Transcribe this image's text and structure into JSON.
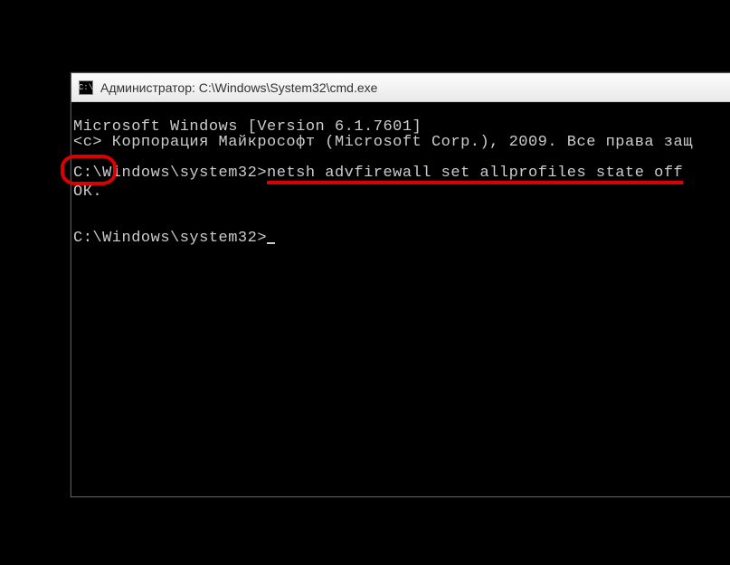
{
  "window": {
    "title": "Администратор: C:\\Windows\\System32\\cmd.exe",
    "icon_label": "C:\\"
  },
  "console": {
    "banner_line1": "Microsoft Windows [Version 6.1.7601]",
    "banner_line2": "<c> Корпорация Майкрософт (Microsoft Corp.), 2009. Все права защ",
    "prompt1_prefix": "C:\\Windows\\system32>",
    "command": "netsh advfirewall set allprofiles state off",
    "result": "ОК.",
    "prompt2": "C:\\Windows\\system32>"
  }
}
